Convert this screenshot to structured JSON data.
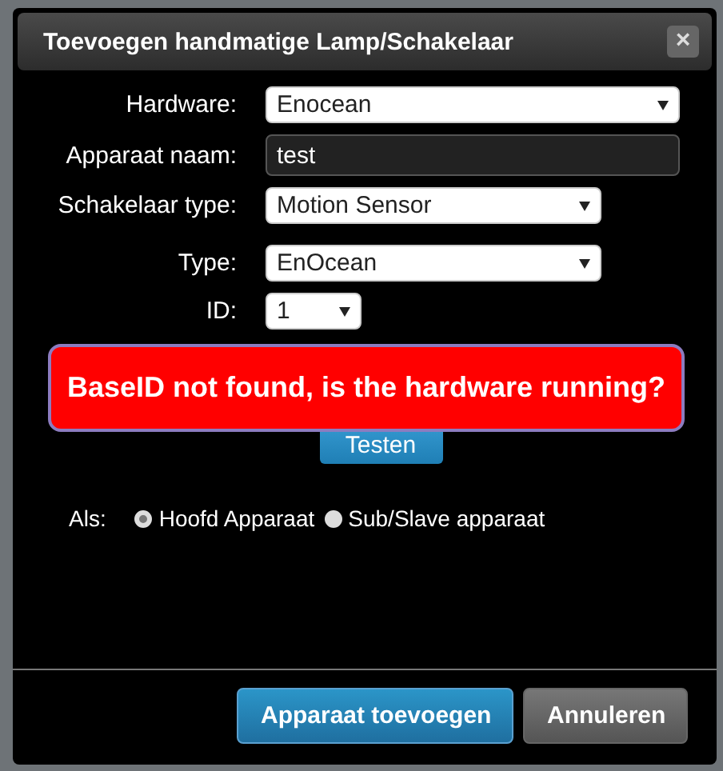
{
  "dialog": {
    "title": "Toevoegen handmatige Lamp/Schakelaar",
    "close": "×"
  },
  "fields": [
    {
      "label": "Hardware:",
      "kind": "select",
      "value": "Enocean"
    },
    {
      "label": "Apparaat naam:",
      "kind": "input",
      "value": "test"
    },
    {
      "label": "Schakelaar type:",
      "kind": "select",
      "value": "Motion Sensor"
    },
    {
      "label": "Type:",
      "kind": "select",
      "value": "EnOcean"
    },
    {
      "label": "ID:",
      "kind": "select",
      "value": "1"
    }
  ],
  "test_button": "Testen",
  "alert": "BaseID not found, is the hardware running?",
  "als": {
    "label": "Als:",
    "options": [
      {
        "label": "Hoofd Apparaat",
        "selected": true
      },
      {
        "label": "Sub/Slave apparaat",
        "selected": false
      }
    ]
  },
  "buttons": [
    {
      "label": "Apparaat toevoegen",
      "kind": "primary"
    },
    {
      "label": "Annuleren",
      "kind": "secondary"
    }
  ]
}
